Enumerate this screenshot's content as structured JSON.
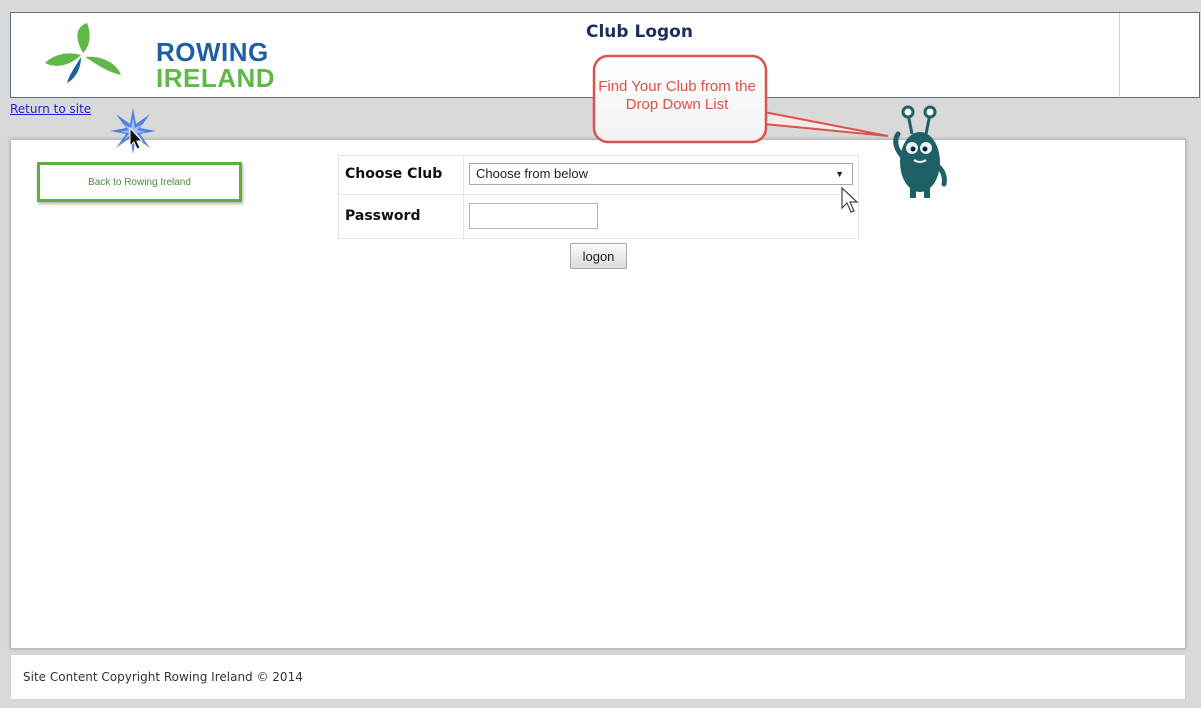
{
  "header": {
    "logo_line1": "ROWING",
    "logo_line2": "IRELAND",
    "page_title": "Club Logon"
  },
  "nav": {
    "return_link": "Return to site",
    "back_button": "Back to Rowing Ireland"
  },
  "form": {
    "club_label": "Choose Club",
    "club_selected": "Choose from below",
    "password_label": "Password",
    "password_value": "",
    "logon_button": "logon"
  },
  "callout": {
    "text": "Find Your Club from the Drop Down List"
  },
  "footer": {
    "copyright": "Site Content Copyright Rowing Ireland © 2014"
  },
  "colors": {
    "logo_blue": "#1f5fa3",
    "logo_green": "#5fb848",
    "title_navy": "#1e2e5a",
    "link_blue": "#2222cc",
    "button_border_green": "#5fae3e",
    "callout_red": "#e0504a",
    "mascot_teal": "#1f5f66"
  },
  "icons": {
    "select_arrow": "dropdown-triangle",
    "cursor": "mouse-pointer",
    "click_effect": "blue-starburst"
  }
}
